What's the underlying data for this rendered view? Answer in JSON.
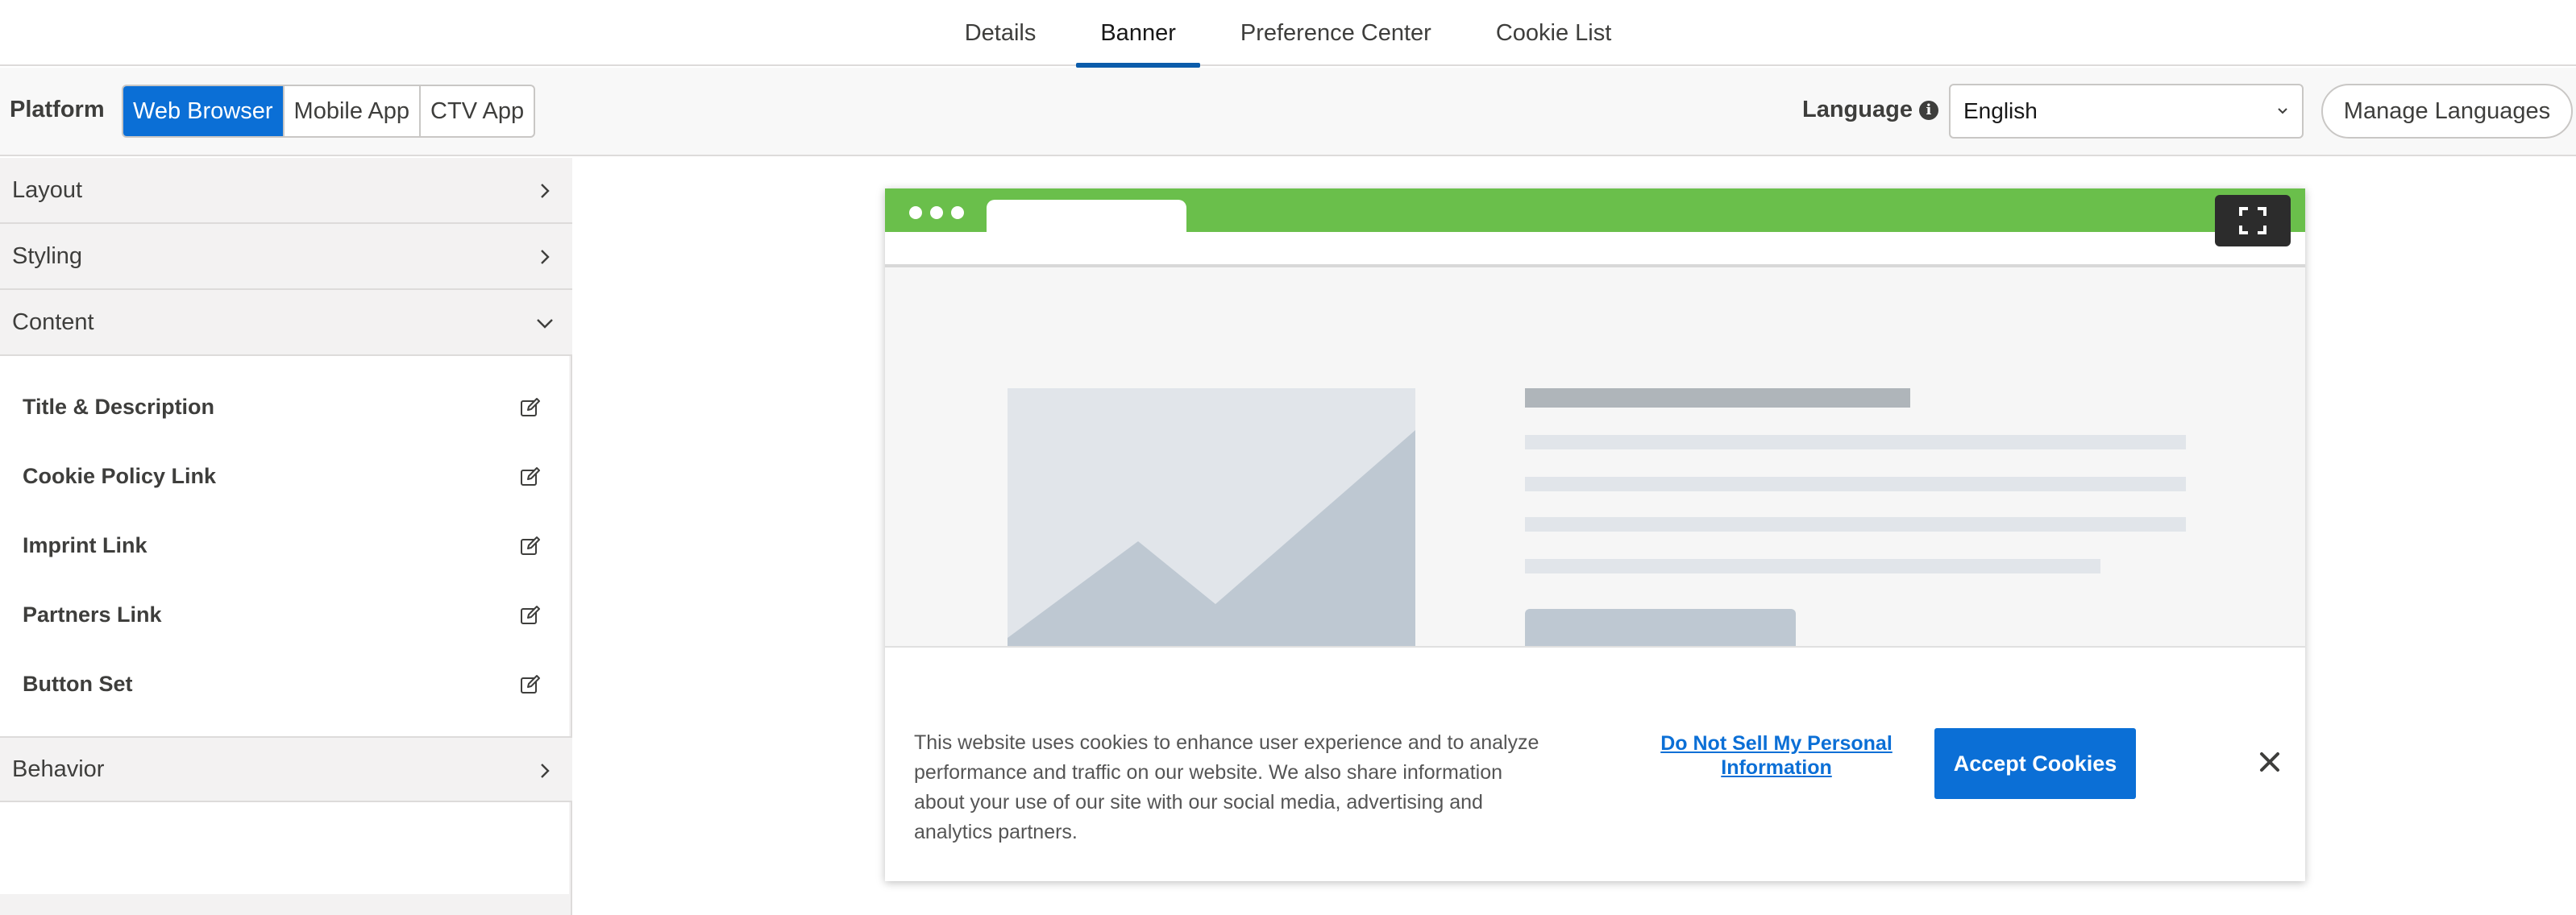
{
  "tabs": [
    {
      "label": "Details"
    },
    {
      "label": "Banner"
    },
    {
      "label": "Preference Center"
    },
    {
      "label": "Cookie List"
    }
  ],
  "active_tab": "Banner",
  "platform": {
    "label": "Platform",
    "options": [
      "Web Browser",
      "Mobile App",
      "CTV App"
    ],
    "selected": "Web Browser"
  },
  "language": {
    "label": "Language",
    "selected": "English",
    "manage_label": "Manage Languages"
  },
  "sidebar": {
    "sections": [
      {
        "label": "Layout",
        "expanded": false
      },
      {
        "label": "Styling",
        "expanded": false
      },
      {
        "label": "Content",
        "expanded": true
      },
      {
        "label": "Behavior",
        "expanded": false
      }
    ],
    "content_items": [
      {
        "label": "Title & Description"
      },
      {
        "label": "Cookie Policy Link"
      },
      {
        "label": "Imprint Link"
      },
      {
        "label": "Partners Link"
      },
      {
        "label": "Button Set"
      }
    ]
  },
  "banner": {
    "text": "This website uses cookies to enhance user experience and to analyze performance and traffic on our website. We also share information about your use of our site with our social media, advertising and analytics partners.",
    "dns_link": "Do Not Sell My Personal Information",
    "accept_label": "Accept Cookies"
  },
  "colors": {
    "accent": "#0b6fd6",
    "browser_chrome": "#6abf4b",
    "tab_underline": "#0b5cab"
  },
  "icons": {
    "info": "info-icon",
    "edit": "edit-icon",
    "fullscreen": "fullscreen-icon",
    "close": "close-icon"
  }
}
